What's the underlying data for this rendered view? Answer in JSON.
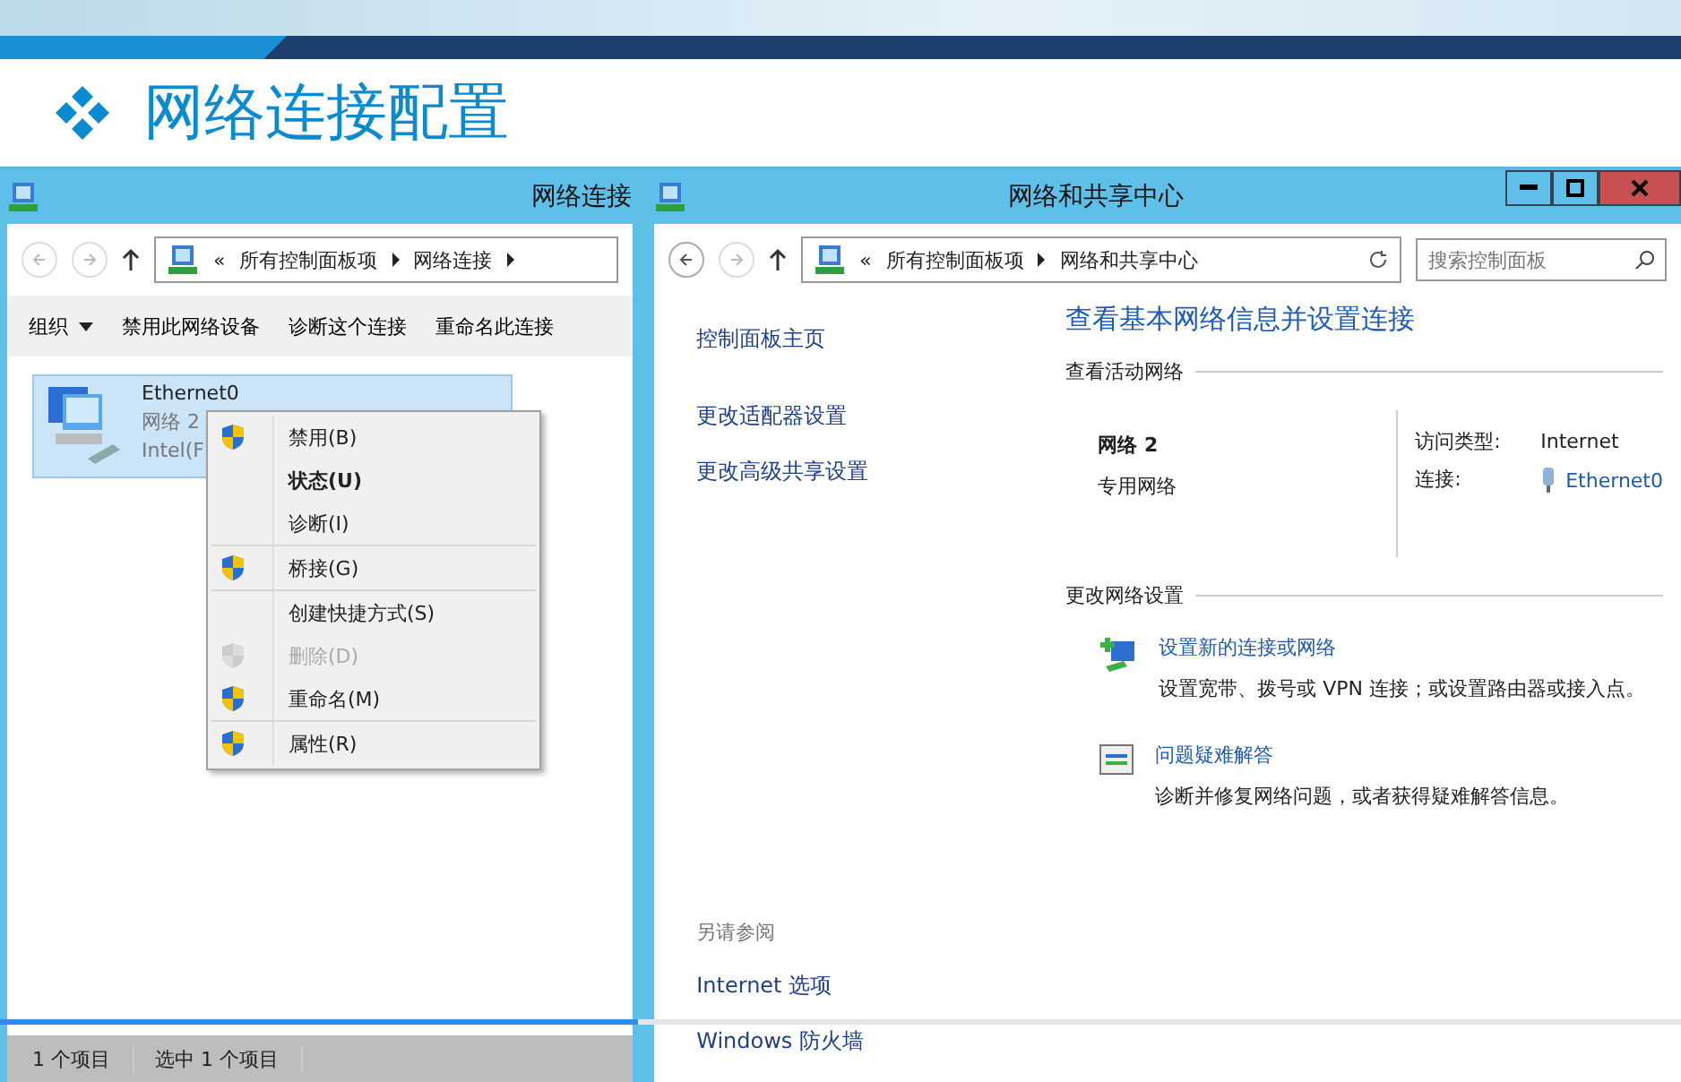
{
  "slide": {
    "title": "网络连接配置"
  },
  "left_window": {
    "title": "网络连接",
    "breadcrumb": [
      "«",
      "所有控制面板项",
      "网络连接"
    ],
    "toolbar": [
      {
        "label": "组织",
        "dropdown": true
      },
      {
        "label": "禁用此网络设备",
        "dropdown": false
      },
      {
        "label": "诊断这个连接",
        "dropdown": false
      },
      {
        "label": "重命名此连接",
        "dropdown": false
      }
    ],
    "items": [
      {
        "name": "Ethernet0",
        "line_2": "网络  2",
        "line_3": "Intel(F",
        "selected": true
      }
    ],
    "context_menu": [
      [
        {
          "label": "禁用(B)",
          "shield": true,
          "default": false,
          "disabled": false
        },
        {
          "label": "状态(U)",
          "shield": false,
          "default": true,
          "disabled": false
        },
        {
          "label": "诊断(I)",
          "shield": false,
          "default": false,
          "disabled": false
        }
      ],
      [
        {
          "label": "桥接(G)",
          "shield": true,
          "default": false,
          "disabled": false
        }
      ],
      [
        {
          "label": "创建快捷方式(S)",
          "shield": false,
          "default": false,
          "disabled": false
        },
        {
          "label": "删除(D)",
          "shield": true,
          "default": false,
          "disabled": true
        },
        {
          "label": "重命名(M)",
          "shield": true,
          "default": false,
          "disabled": false
        }
      ],
      [
        {
          "label": "属性(R)",
          "shield": true,
          "default": false,
          "disabled": false
        }
      ]
    ],
    "status_bar": [
      "1 个项目",
      "选中 1 个项目"
    ]
  },
  "right_window": {
    "title": "网络和共享中心",
    "breadcrumb": [
      "«",
      "所有控制面板项",
      "网络和共享中心"
    ],
    "search": {
      "placeholder": "搜索控制面板"
    },
    "sidebar": {
      "items": [
        "控制面板主页",
        "更改适配器设置",
        "更改高级共享设置"
      ],
      "see_also_heading": "另请参阅",
      "see_also": [
        "Internet 选项",
        "Windows 防火墙"
      ]
    },
    "heading": "查看基本网络信息并设置连接",
    "active_networks": {
      "heading": "查看活动网络",
      "name": "网络  2",
      "category": "专用网络",
      "fields": [
        {
          "label": "访问类型:",
          "value": "Internet",
          "link": false
        },
        {
          "label": "连接:",
          "value": "Ethernet0",
          "link": true
        }
      ]
    },
    "change_settings": {
      "heading": "更改网络设置",
      "tasks": [
        {
          "kind": "new-connection",
          "title": "设置新的连接或网络",
          "description": "设置宽带、拨号或 VPN 连接；或设置路由器或接入点。"
        },
        {
          "kind": "troubleshoot",
          "title": "问题疑难解答",
          "description": "诊断并修复网络问题，或者获得疑难解答信息。"
        }
      ]
    }
  },
  "video_progress": {
    "level": 0.38
  }
}
